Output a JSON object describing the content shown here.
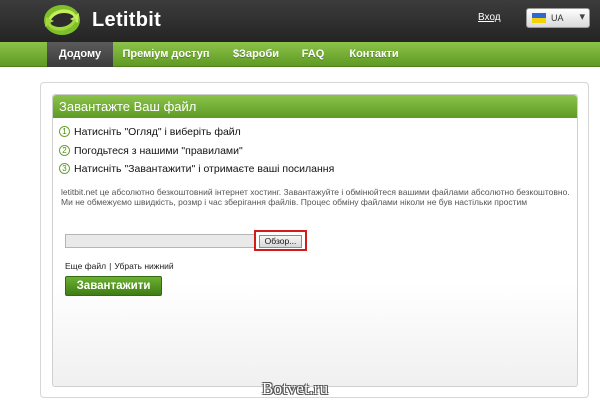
{
  "header": {
    "logo_text": "Letitbit",
    "login_link": "Вход",
    "language": {
      "code": "UA",
      "flag": "ukraine-flag"
    }
  },
  "nav": {
    "items": [
      {
        "label": "Додому",
        "active": true
      },
      {
        "label": "Преміум доступ",
        "active": false
      },
      {
        "label": "$Зароби",
        "active": false
      },
      {
        "label": "FAQ",
        "active": false
      },
      {
        "label": "Контакти",
        "active": false
      }
    ]
  },
  "upload_panel": {
    "title": "Завантажте Ваш файл",
    "steps": [
      {
        "num": "1",
        "text": "Натисніть \"Огляд\" і виберіть файл"
      },
      {
        "num": "2",
        "text": "Погодьтеся з нашими \"правилами\""
      },
      {
        "num": "3",
        "text": "Натисніть \"Завантажити\" і отримаєте ваші посилання"
      }
    ],
    "description": "letitbit.net це абсолютно безкоштовний інтернет хостинг. Завантажуйте і обмінюйтеся вашими файлами абсолютно безкоштовно. Ми не обмежуємо швидкість, розмр і час зберігання файлів. Процес обміну файлами ніколи не був настільки простим",
    "file_input_value": "",
    "browse_label": "Обзор...",
    "more_file_link": "Еще файл",
    "remove_last_link": "Убрать нижний",
    "upload_button": "Завантажити"
  },
  "watermark": "Botvet.ru",
  "colors": {
    "header_dark": "#2f2f2f",
    "brand_green": "#6aa82c",
    "highlight_red": "#d31b1b"
  }
}
